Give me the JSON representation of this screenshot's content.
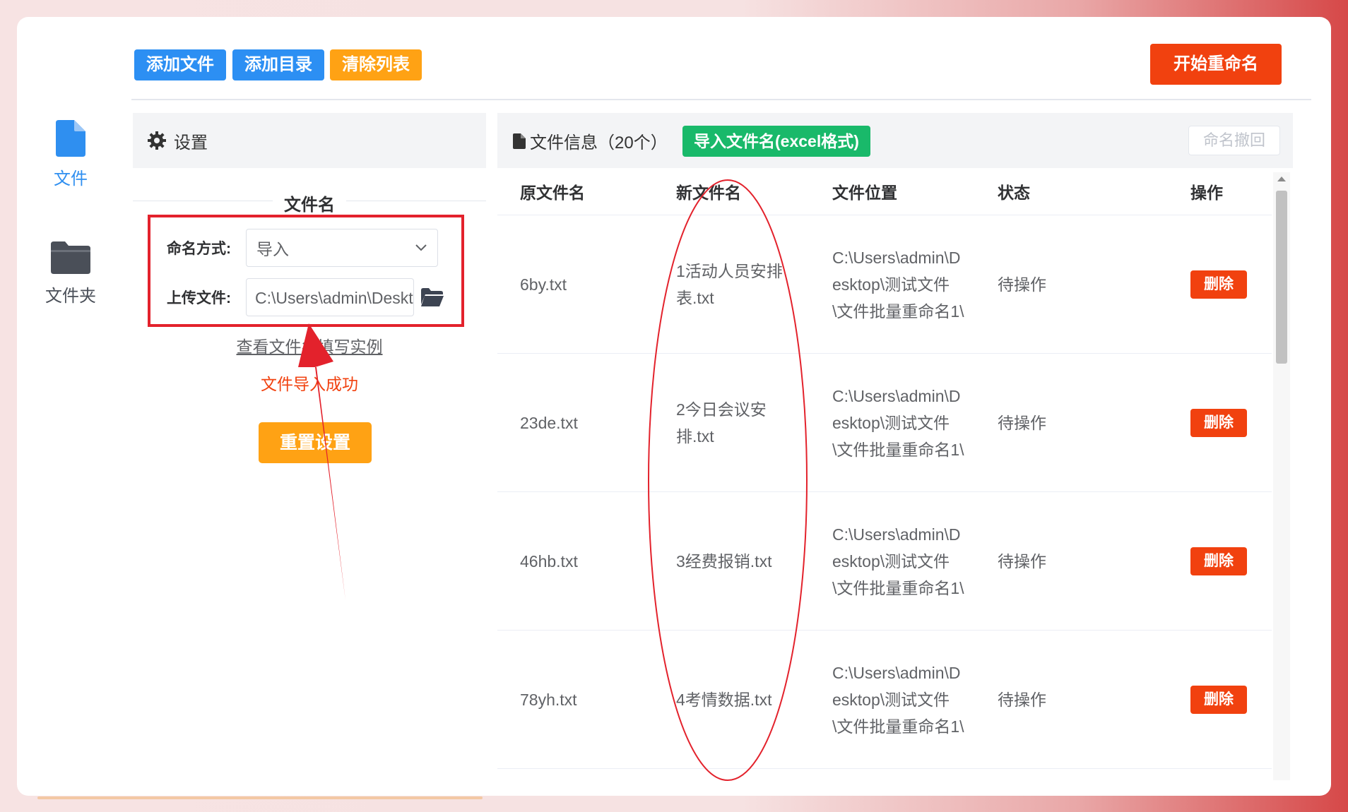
{
  "colors": {
    "primary_blue": "#2c8ff3",
    "orange": "#ffa214",
    "red": "#f1410f",
    "green": "#19b96a",
    "annotation_red": "#e3222c"
  },
  "sidebar": {
    "items": [
      {
        "label": "文件",
        "icon": "file-icon"
      },
      {
        "label": "文件夹",
        "icon": "folder-icon"
      }
    ]
  },
  "toolbar": {
    "add_file": "添加文件",
    "add_dir": "添加目录",
    "clear_list": "清除列表",
    "start_rename": "开始重命名"
  },
  "settings": {
    "header": "设置",
    "section_title": "文件名",
    "naming_method_label": "命名方式:",
    "naming_method_value": "导入",
    "upload_label": "上传文件:",
    "upload_value": "C:\\Users\\admin\\Desktop",
    "example_link": "查看文件名填写实例",
    "success_msg": "文件导入成功",
    "reset_btn": "重置设置"
  },
  "files": {
    "title": "文件信息（20个）",
    "import_btn": "导入文件名(excel格式)",
    "undo_btn": "命名撤回",
    "columns": [
      "原文件名",
      "新文件名",
      "文件位置",
      "状态",
      "操作"
    ],
    "rows": [
      {
        "original": "6by.txt",
        "new_name": "1活动人员安排表.txt",
        "path": "C:\\Users\\admin\\Desktop\\测试文件\\文件批量重命名1\\",
        "status": "待操作",
        "action": "删除"
      },
      {
        "original": "23de.txt",
        "new_name": "2今日会议安排.txt",
        "path": "C:\\Users\\admin\\Desktop\\测试文件\\文件批量重命名1\\",
        "status": "待操作",
        "action": "删除"
      },
      {
        "original": "46hb.txt",
        "new_name": "3经费报销.txt",
        "path": "C:\\Users\\admin\\Desktop\\测试文件\\文件批量重命名1\\",
        "status": "待操作",
        "action": "删除"
      },
      {
        "original": "78yh.txt",
        "new_name": "4考情数据.txt",
        "path": "C:\\Users\\admin\\Desktop\\测试文件\\文件批量重命名1\\",
        "status": "待操作",
        "action": "删除"
      }
    ]
  }
}
